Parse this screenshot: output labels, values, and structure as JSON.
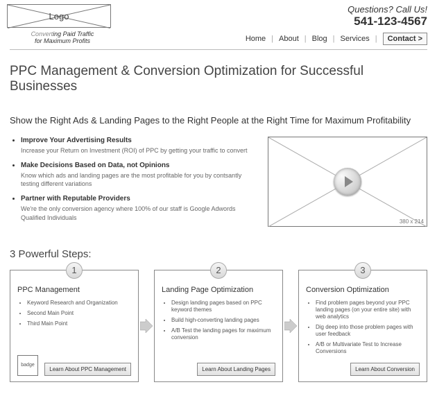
{
  "header": {
    "logo_label": "Logo",
    "tagline_html": "Converting Paid Traffic for Maximum Profits",
    "questions": "Questions?  Call Us!",
    "phone": "541-123-4567",
    "nav": [
      "Home",
      "About",
      "Blog",
      "Services"
    ],
    "contact": "Contact >"
  },
  "headline": "PPC Management & Conversion Optimization for Successful Businesses",
  "subheadline": "Show the Right Ads & Landing Pages to the Right People at the Right Time for Maximum Profitability",
  "benefits": [
    {
      "title": "Improve Your Advertising Results",
      "desc": "Increase your Return on Investment (ROI) of PPC by getting your traffic to convert"
    },
    {
      "title": "Make Decisions Based on Data, not Opinions",
      "desc": "Know which ads and landing pages are the most profitable for you by contsantly testing different variations"
    },
    {
      "title": "Partner with Reputable Providers",
      "desc": "We're the only conversion agency where 100% of our staff is Google Adwords Qualified Individuals"
    }
  ],
  "video": {
    "dimensions": "380 x 214"
  },
  "steps_heading": "3 Powerful Steps:",
  "steps": [
    {
      "num": "1",
      "title": "PPC Management",
      "points": [
        "Keyword Research and Organization",
        "Second Main Point",
        "Third Main Point"
      ],
      "badge": "badge",
      "cta": "Learn About PPC Management"
    },
    {
      "num": "2",
      "title": "Landing Page Optimization",
      "points": [
        "Design landing pages based on PPC keyword themes",
        "Build high-converting landing pages",
        "A/B Test the landing pages for maximum conversion"
      ],
      "cta": "Learn About Landing Pages"
    },
    {
      "num": "3",
      "title": "Conversion Optimization",
      "points": [
        "Find problem pages beyond your PPC landing pages (on your entire site) with web analytics",
        "Dig deep into those problem pages with user feedback",
        "A/B or Multivariate Test to Increase Conversions"
      ],
      "cta": "Learn About Conversion"
    }
  ]
}
